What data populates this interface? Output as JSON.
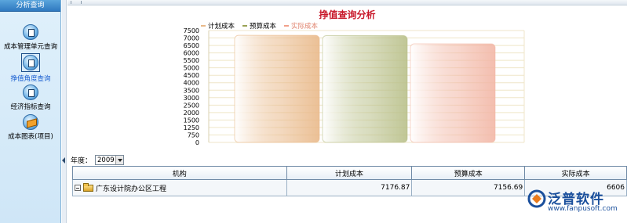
{
  "sidebar": {
    "title": "分析查询",
    "items": [
      {
        "label": "成本管理单元查询"
      },
      {
        "label": "挣值角度查询"
      },
      {
        "label": "经济指标查询"
      },
      {
        "label": "成本图表(项目)"
      }
    ]
  },
  "chart_data": {
    "type": "bar",
    "title": "挣值查询分析",
    "categories": [
      ""
    ],
    "series": [
      {
        "name": "计划成本",
        "values": [
          7176.87
        ],
        "color": "#e9b98a"
      },
      {
        "name": "预算成本",
        "values": [
          7156.69
        ],
        "color": "#b9c08a"
      },
      {
        "name": "实际成本",
        "values": [
          6606
        ],
        "color": "#f2b7a6"
      }
    ],
    "y_ticks": [
      "7500",
      "7000",
      "6500",
      "6000",
      "5500",
      "5000",
      "4500",
      "4000",
      "3500",
      "3000",
      "2500",
      "2000",
      "1500",
      "1250",
      "750",
      "0"
    ],
    "ylim": [
      0,
      7500
    ],
    "grid": true,
    "legend_position": "top-left"
  },
  "filters": {
    "year_label": "年度：",
    "year_value": "2009"
  },
  "table": {
    "headers": [
      "机构",
      "计划成本",
      "预算成本",
      "实际成本"
    ],
    "rows": [
      {
        "org": "广东设计院办公区工程",
        "plan": "7176.87",
        "budget": "7156.69",
        "actual": "6606"
      }
    ]
  },
  "logo": {
    "name": "泛普软件",
    "url": "www.fanpusoft.com",
    "brand_color": "#1a4f9c"
  }
}
